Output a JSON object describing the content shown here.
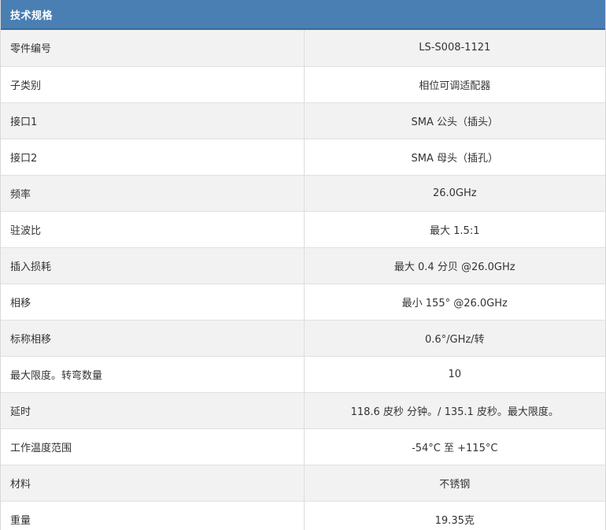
{
  "header": {
    "title": "技术规格"
  },
  "rows": [
    {
      "label": "零件编号",
      "value": "LS-S008-1121"
    },
    {
      "label": "子类别",
      "value": "相位可调适配器"
    },
    {
      "label": "接口1",
      "value": "SMA 公头（插头）"
    },
    {
      "label": "接口2",
      "value": "SMA 母头（插孔）"
    },
    {
      "label": "频率",
      "value": "26.0GHz"
    },
    {
      "label": "驻波比",
      "value": "最大 1.5:1"
    },
    {
      "label": "插入损耗",
      "value": "最大 0.4 分贝 @26.0GHz"
    },
    {
      "label": "相移",
      "value": "最小 155° @26.0GHz"
    },
    {
      "label": "标称相移",
      "value": "0.6°/GHz/转"
    },
    {
      "label": "最大限度。转弯数量",
      "value": "10"
    },
    {
      "label": "延时",
      "value": "118.6 皮秒 分钟。/ 135.1 皮秒。最大限度。"
    },
    {
      "label": "工作温度范围",
      "value": "-54°C 至 +115°C"
    },
    {
      "label": "材料",
      "value": "不锈钢"
    },
    {
      "label": "重量",
      "value": "19.35克"
    }
  ]
}
